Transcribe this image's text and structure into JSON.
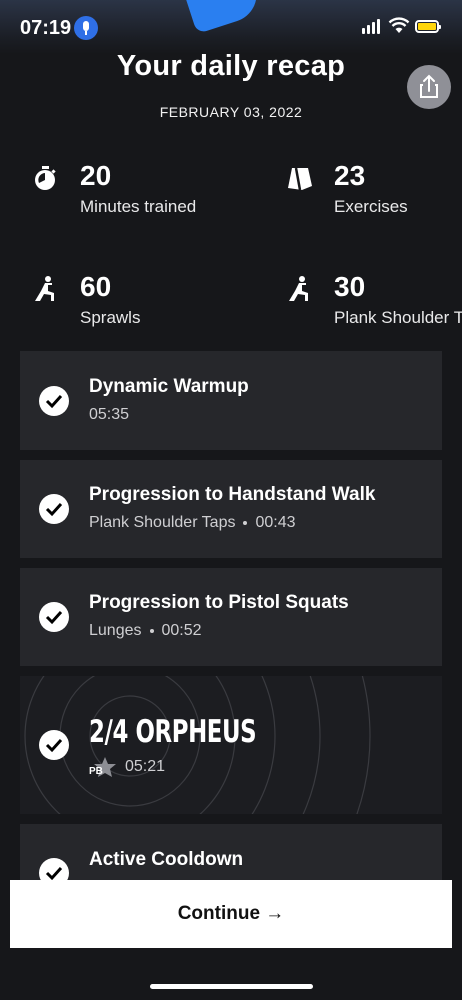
{
  "status_bar": {
    "time": "07:19"
  },
  "header": {
    "title": "Your daily recap",
    "date": "FEBRUARY 03, 2022"
  },
  "stats": [
    {
      "value": "20",
      "label": "Minutes trained",
      "icon": "stopwatch-icon"
    },
    {
      "value": "23",
      "label": "Exercises",
      "icon": "exercises-icon"
    },
    {
      "value": "60",
      "label": "Sprawls",
      "icon": "lunge-figure-icon"
    },
    {
      "value": "30",
      "label": "Plank Shoulder Taps",
      "icon": "lunge-figure-icon"
    }
  ],
  "workouts": [
    {
      "title": "Dynamic Warmup",
      "detail": "",
      "duration": "05:35"
    },
    {
      "title": "Progression to Handstand Walk",
      "detail": "Plank Shoulder Taps",
      "duration": "00:43"
    },
    {
      "title": "Progression to Pistol Squats",
      "detail": "Lunges",
      "duration": "00:52"
    },
    {
      "title": "2/4 ORPHEUS",
      "badge": "PB",
      "duration": "05:21"
    },
    {
      "title": "Active Cooldown"
    }
  ],
  "footer": {
    "continue_label": "Continue →"
  },
  "colors": {
    "background": "#16171a",
    "card": "#26272b",
    "accent_blue": "#2f6fe6",
    "battery": "#ffd60a"
  }
}
